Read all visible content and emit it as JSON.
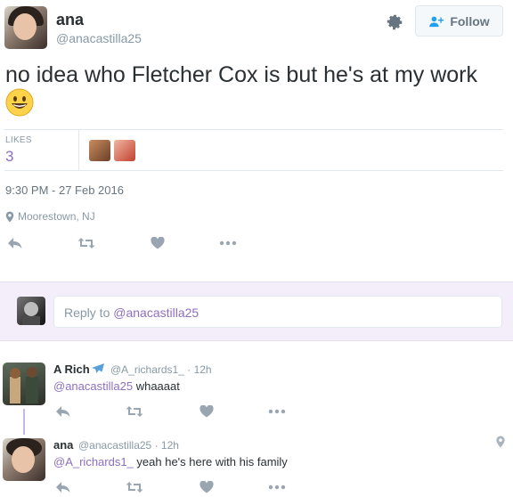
{
  "tweet": {
    "author_name": "ana",
    "author_handle": "@anacastilla25",
    "follow_label": "Follow",
    "text": "no idea who Fletcher Cox is but he's at my work",
    "emoji_icon": "grinning-face-emoji",
    "likes_label": "LIKES",
    "likes_count": "3",
    "timestamp": "9:30 PM - 27 Feb 2016",
    "location": "Moorestown, NJ"
  },
  "reply_box": {
    "prefix": "Reply to ",
    "mention": "@anacastilla25"
  },
  "replies": [
    {
      "name": "A Rich",
      "name_icon": "airplane-emoji",
      "handle": "@A_richards1_",
      "time": "· 12h",
      "mention": "@anacastilla25",
      "text": " whaaaat"
    },
    {
      "name": "ana",
      "handle": "@anacastilla25",
      "time": "· 12h",
      "mention": "@A_richards1_",
      "text": " yeah he's here with his family"
    }
  ],
  "colors": {
    "accent": "#8c6fbf",
    "muted": "#8899a6",
    "text": "#292f33"
  }
}
